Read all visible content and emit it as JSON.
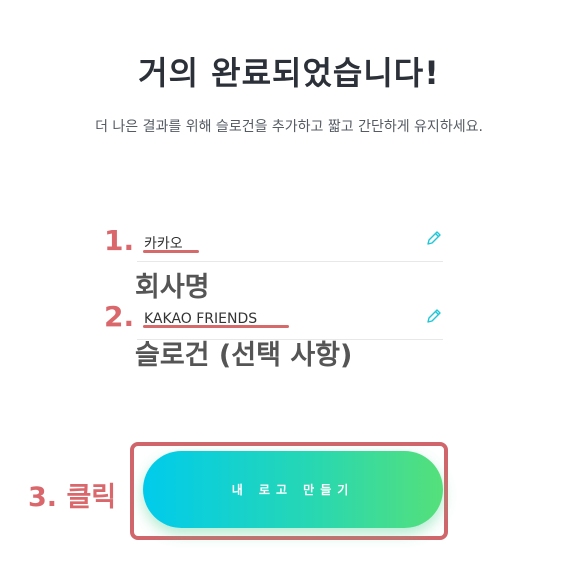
{
  "header": {
    "title": "거의 완료되었습니다!",
    "subtitle": "더 나은 결과를 위해 슬로건을 추가하고 짧고 간단하게 유지하세요."
  },
  "form": {
    "company": {
      "label": "회사명",
      "value": "카카오"
    },
    "slogan": {
      "label": "슬로건 (선택 사항)",
      "value": "KAKAO FRIENDS"
    },
    "edit_icon": "pencil-icon"
  },
  "annotations": {
    "step1": "1.",
    "step2": "2.",
    "step3": "3. 클릭",
    "color": "#d9676b"
  },
  "cta": {
    "label": "내 로고 만들기",
    "gradient_start": "#00cbec",
    "gradient_end": "#55e07a"
  }
}
